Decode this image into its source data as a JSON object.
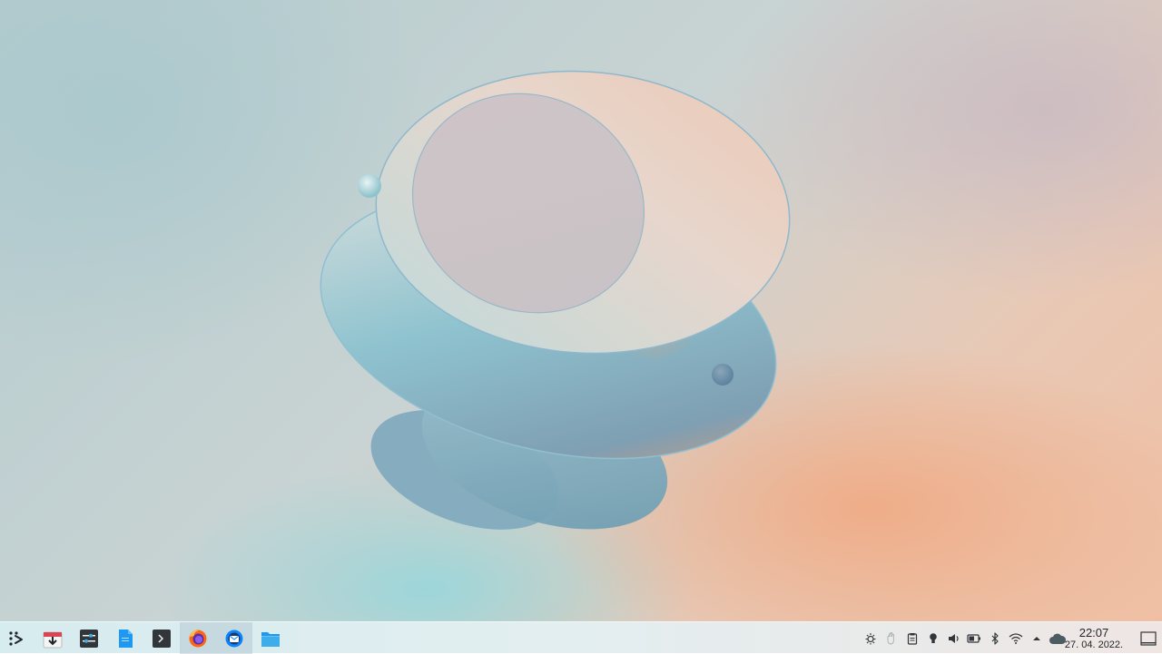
{
  "taskbar": {
    "launcher_icon": "application-launcher-icon",
    "tasks": [
      {
        "name": "software-center",
        "icon": "discover-icon",
        "active": false
      },
      {
        "name": "system-settings",
        "icon": "settings-icon",
        "active": false
      },
      {
        "name": "text-editor",
        "icon": "document-icon",
        "active": false
      },
      {
        "name": "terminal",
        "icon": "terminal-icon",
        "active": false
      },
      {
        "name": "firefox",
        "icon": "firefox-icon",
        "active": true
      },
      {
        "name": "thunderbird",
        "icon": "thunderbird-icon",
        "active": true
      },
      {
        "name": "file-manager",
        "icon": "folder-icon",
        "active": false
      }
    ],
    "tray_icons": [
      "notifications-icon",
      "touchpad-icon",
      "clipboard-icon",
      "night-color-icon",
      "volume-icon",
      "battery-icon",
      "bluetooth-icon",
      "wifi-icon",
      "expand-arrow-icon",
      "weather-cloud-icon"
    ],
    "clock": {
      "time": "22:07",
      "date": "27. 04. 2022."
    },
    "show_desktop_icon": "show-desktop-icon"
  },
  "colors": {
    "taskbar_text": "#232629",
    "accent_blue": "#3daee9",
    "firefox_orange": "#ff6611"
  }
}
